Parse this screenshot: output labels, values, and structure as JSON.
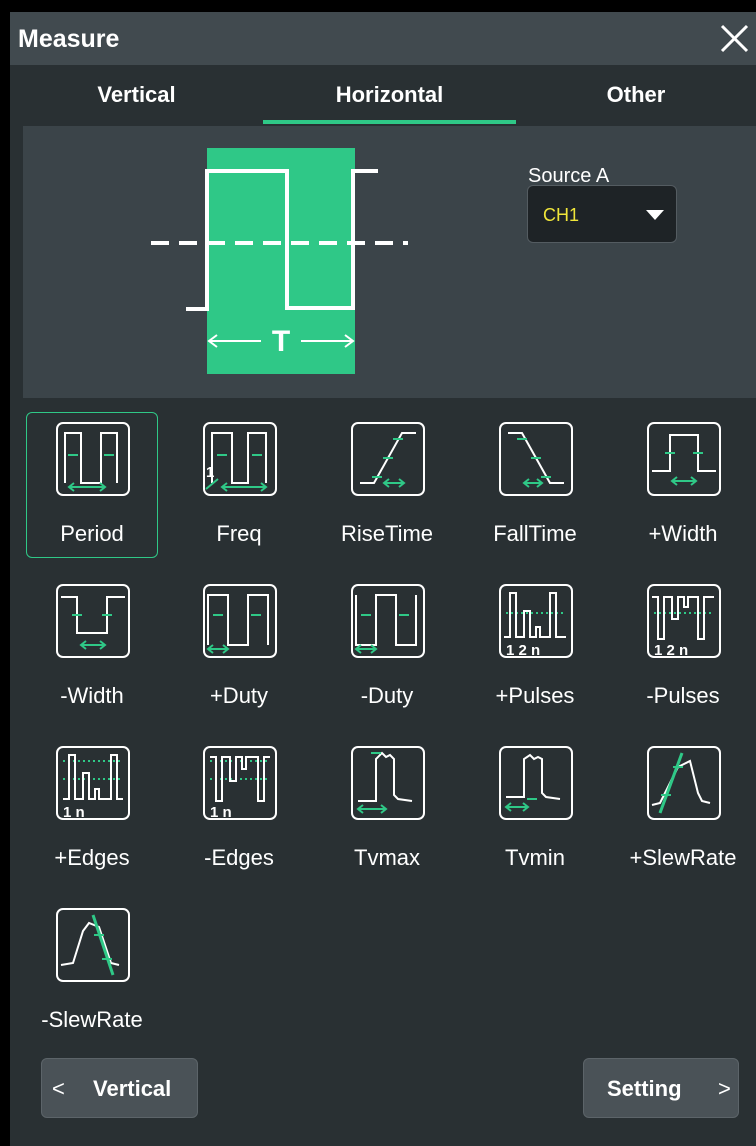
{
  "title": "Measure",
  "tabs": [
    {
      "label": "Vertical"
    },
    {
      "label": "Horizontal"
    },
    {
      "label": "Other"
    }
  ],
  "active_tab": "Horizontal",
  "preview": {
    "period_label": "T"
  },
  "source": {
    "label": "Source A",
    "value": "CH1"
  },
  "items": [
    {
      "label": "Period",
      "icon": "period-icon",
      "selected": true
    },
    {
      "label": "Freq",
      "icon": "freq-icon"
    },
    {
      "label": "RiseTime",
      "icon": "rise-time-icon"
    },
    {
      "label": "FallTime",
      "icon": "fall-time-icon"
    },
    {
      "label": "+Width",
      "icon": "positive-width-icon"
    },
    {
      "label": "-Width",
      "icon": "negative-width-icon"
    },
    {
      "label": "+Duty",
      "icon": "positive-duty-icon"
    },
    {
      "label": "-Duty",
      "icon": "negative-duty-icon"
    },
    {
      "label": "+Pulses",
      "icon": "positive-pulses-icon"
    },
    {
      "label": "-Pulses",
      "icon": "negative-pulses-icon"
    },
    {
      "label": "+Edges",
      "icon": "positive-edges-icon"
    },
    {
      "label": "-Edges",
      "icon": "negative-edges-icon"
    },
    {
      "label": "Tvmax",
      "icon": "tvmax-icon"
    },
    {
      "label": "Tvmin",
      "icon": "tvmin-icon"
    },
    {
      "label": "+SlewRate",
      "icon": "positive-slewrate-icon"
    },
    {
      "label": "-SlewRate",
      "icon": "negative-slewrate-icon"
    }
  ],
  "icon_texts": {
    "one": "1",
    "two": "2",
    "n": "n"
  },
  "nav": {
    "prev_label": "Vertical",
    "next_label": "Setting",
    "prev_chevron": "<",
    "next_chevron": ">"
  },
  "colors": {
    "accent": "#2fc887",
    "source_value": "#f0e63a",
    "panel": "#293033"
  }
}
